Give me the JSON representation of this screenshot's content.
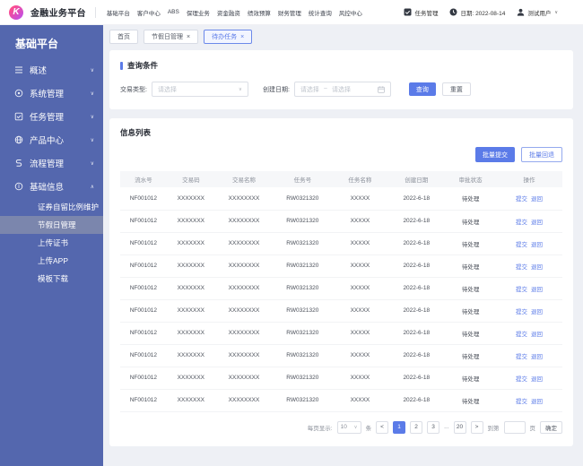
{
  "topbar": {
    "logo_glyph": "K",
    "title": "金融业务平台",
    "nav": [
      "基础平台",
      "客户中心",
      "ABS",
      "保理业务",
      "资金融资",
      "绩效预算",
      "财务管理",
      "统计查询",
      "风控中心"
    ],
    "task_label": "任务管理",
    "date_label": "日期: 2022-08-14",
    "user_label": "测试用户"
  },
  "sidebar": {
    "title": "基础平台",
    "items": [
      {
        "key": "overview",
        "label": "概述",
        "icon": "menu-icon",
        "expanded": false
      },
      {
        "key": "system-mgmt",
        "label": "系统管理",
        "icon": "system-icon",
        "expanded": false
      },
      {
        "key": "task-mgmt",
        "label": "任务管理",
        "icon": "task-icon",
        "expanded": false
      },
      {
        "key": "product-center",
        "label": "产品中心",
        "icon": "product-icon",
        "expanded": false
      },
      {
        "key": "process-mgmt",
        "label": "流程管理",
        "icon": "flow-icon",
        "expanded": false
      },
      {
        "key": "basic-info",
        "label": "基础信息",
        "icon": "info-icon",
        "expanded": true
      }
    ],
    "subitems": [
      {
        "key": "security-retain-ratio",
        "label": "证券自留比例维护",
        "active": false
      },
      {
        "key": "holiday-mgmt",
        "label": "节假日管理",
        "active": true
      },
      {
        "key": "upload-cert",
        "label": "上传证书",
        "active": false
      },
      {
        "key": "upload-app",
        "label": "上传APP",
        "active": false
      },
      {
        "key": "template-download",
        "label": "模板下载",
        "active": false
      }
    ]
  },
  "tabs": [
    {
      "key": "home",
      "label": "首页",
      "closable": false,
      "active": false
    },
    {
      "key": "holiday-mgmt",
      "label": "节假日管理",
      "closable": true,
      "active": false
    },
    {
      "key": "todo-tasks",
      "label": "待办任务",
      "closable": true,
      "active": true
    }
  ],
  "query": {
    "section_title": "查询条件",
    "type_label": "交易类型:",
    "type_placeholder": "请选择",
    "date_label": "创建日期:",
    "date_start_placeholder": "请选择",
    "date_separator": "~",
    "date_end_placeholder": "请选择",
    "search_button": "查询",
    "reset_button": "重置"
  },
  "list": {
    "section_title": "信息列表",
    "batch_submit": "批量提交",
    "batch_rollback": "批量回退",
    "columns": [
      "流水号",
      "交易码",
      "交易名称",
      "任务号",
      "任务名称",
      "创建日期",
      "审批状态",
      "操作"
    ],
    "rows": [
      {
        "cells": [
          "NF001012",
          "XXXXXXX",
          "XXXXXXXX",
          "RW0321320",
          "XXXXX",
          "2022-6-18",
          "待处理"
        ],
        "actions": [
          "提交",
          "退回"
        ]
      },
      {
        "cells": [
          "NF001012",
          "XXXXXXX",
          "XXXXXXXX",
          "RW0321320",
          "XXXXX",
          "2022-6-18",
          "待处理"
        ],
        "actions": [
          "提交",
          "退回"
        ]
      },
      {
        "cells": [
          "NF001012",
          "XXXXXXX",
          "XXXXXXXX",
          "RW0321320",
          "XXXXX",
          "2022-6-18",
          "待处理"
        ],
        "actions": [
          "提交",
          "退回"
        ]
      },
      {
        "cells": [
          "NF001012",
          "XXXXXXX",
          "XXXXXXXX",
          "RW0321320",
          "XXXXX",
          "2022-6-18",
          "待处理"
        ],
        "actions": [
          "提交",
          "退回"
        ]
      },
      {
        "cells": [
          "NF001012",
          "XXXXXXX",
          "XXXXXXXX",
          "RW0321320",
          "XXXXX",
          "2022-6-18",
          "待处理"
        ],
        "actions": [
          "提交",
          "退回"
        ]
      },
      {
        "cells": [
          "NF001012",
          "XXXXXXX",
          "XXXXXXXX",
          "RW0321320",
          "XXXXX",
          "2022-6-18",
          "待处理"
        ],
        "actions": [
          "提交",
          "退回"
        ]
      },
      {
        "cells": [
          "NF001012",
          "XXXXXXX",
          "XXXXXXXX",
          "RW0321320",
          "XXXXX",
          "2022-6-18",
          "待处理"
        ],
        "actions": [
          "提交",
          "退回"
        ]
      },
      {
        "cells": [
          "NF001012",
          "XXXXXXX",
          "XXXXXXXX",
          "RW0321320",
          "XXXXX",
          "2022-6-18",
          "待处理"
        ],
        "actions": [
          "提交",
          "退回"
        ]
      },
      {
        "cells": [
          "NF001012",
          "XXXXXXX",
          "XXXXXXXX",
          "RW0321320",
          "XXXXX",
          "2022-6-18",
          "待处理"
        ],
        "actions": [
          "提交",
          "退回"
        ]
      },
      {
        "cells": [
          "NF001012",
          "XXXXXXX",
          "XXXXXXXX",
          "RW0321320",
          "XXXXX",
          "2022-6-18",
          "待处理"
        ],
        "actions": [
          "提交",
          "退回"
        ]
      }
    ]
  },
  "pagination": {
    "per_page_label": "每页显示:",
    "per_page_value": "10",
    "unit_label": "条",
    "pages": [
      "1",
      "2",
      "3",
      "...",
      "20"
    ],
    "active_page": "1",
    "goto_label": "到第",
    "goto_unit": "页",
    "confirm_label": "确定"
  },
  "icon_glyphs": {
    "chevron_down": "∨",
    "chevron_up": "∧",
    "close": "×",
    "prev": "<",
    "next": ">"
  },
  "colors": {
    "primary": "#5b7be8",
    "sidebar": "#5467ae",
    "sidebar_active": "#7b86ad",
    "content_bg": "#eef0f5",
    "logo_gradient_start": "#ff4d88",
    "logo_gradient_end": "#c44fe2"
  }
}
